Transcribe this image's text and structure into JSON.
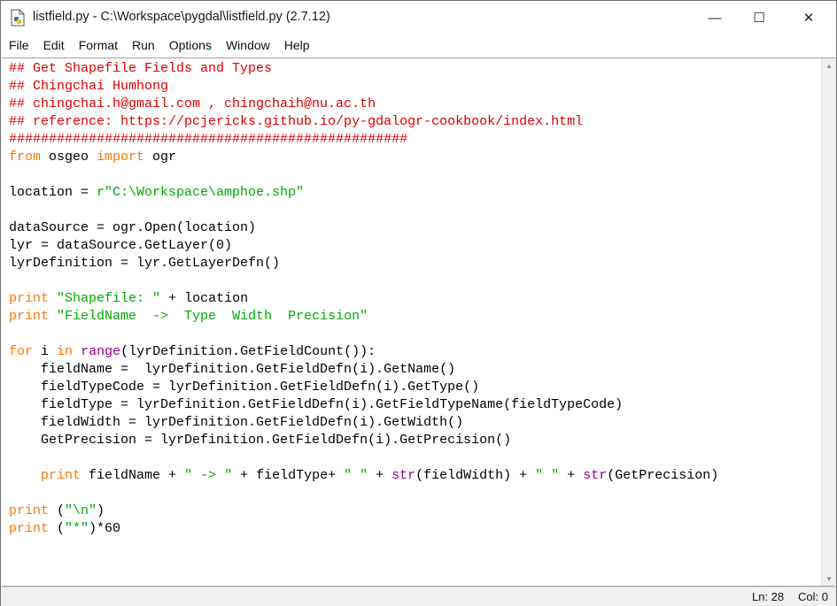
{
  "window": {
    "title": "listfield.py - C:\\Workspace\\pygdal\\listfield.py (2.7.12)",
    "icon": "python-file-icon",
    "controls": {
      "minimize": "—",
      "maximize": "☐",
      "close": "✕"
    }
  },
  "menu": [
    "File",
    "Edit",
    "Format",
    "Run",
    "Options",
    "Window",
    "Help"
  ],
  "colors": {
    "comment": "#dd0000",
    "keyword": "#ff7700",
    "builtin": "#900090",
    "string": "#00aa00",
    "text": "#000000"
  },
  "code_lines": [
    [
      [
        "comment",
        "## Get Shapefile Fields and Types"
      ]
    ],
    [
      [
        "comment",
        "## Chingchai Humhong"
      ]
    ],
    [
      [
        "comment",
        "## chingchai.h@gmail.com , chingchaih@nu.ac.th"
      ]
    ],
    [
      [
        "comment",
        "## reference: https://pcjericks.github.io/py-gdalogr-cookbook/index.html"
      ]
    ],
    [
      [
        "comment",
        "##################################################"
      ]
    ],
    [
      [
        "keyword",
        "from"
      ],
      [
        "plain",
        " osgeo "
      ],
      [
        "keyword",
        "import"
      ],
      [
        "plain",
        " ogr"
      ]
    ],
    [],
    [
      [
        "plain",
        "location = "
      ],
      [
        "string",
        "r\"C:\\Workspace\\amphoe.shp\""
      ]
    ],
    [],
    [
      [
        "plain",
        "dataSource = ogr.Open(location)"
      ]
    ],
    [
      [
        "plain",
        "lyr = dataSource.GetLayer(0)"
      ]
    ],
    [
      [
        "plain",
        "lyrDefinition = lyr.GetLayerDefn()"
      ]
    ],
    [],
    [
      [
        "keyword",
        "print"
      ],
      [
        "plain",
        " "
      ],
      [
        "string",
        "\"Shapefile: \""
      ],
      [
        "plain",
        " + location"
      ]
    ],
    [
      [
        "keyword",
        "print"
      ],
      [
        "plain",
        " "
      ],
      [
        "string",
        "\"FieldName  ->  Type  Width  Precision\""
      ]
    ],
    [],
    [
      [
        "keyword",
        "for"
      ],
      [
        "plain",
        " i "
      ],
      [
        "keyword",
        "in"
      ],
      [
        "plain",
        " "
      ],
      [
        "builtin",
        "range"
      ],
      [
        "plain",
        "(lyrDefinition.GetFieldCount()):"
      ]
    ],
    [
      [
        "plain",
        "    fieldName =  lyrDefinition.GetFieldDefn(i).GetName()"
      ]
    ],
    [
      [
        "plain",
        "    fieldTypeCode = lyrDefinition.GetFieldDefn(i).GetType()"
      ]
    ],
    [
      [
        "plain",
        "    fieldType = lyrDefinition.GetFieldDefn(i).GetFieldTypeName(fieldTypeCode)"
      ]
    ],
    [
      [
        "plain",
        "    fieldWidth = lyrDefinition.GetFieldDefn(i).GetWidth()"
      ]
    ],
    [
      [
        "plain",
        "    GetPrecision = lyrDefinition.GetFieldDefn(i).GetPrecision()"
      ]
    ],
    [],
    [
      [
        "plain",
        "    "
      ],
      [
        "keyword",
        "print"
      ],
      [
        "plain",
        " fieldName + "
      ],
      [
        "string",
        "\" -> \""
      ],
      [
        "plain",
        " + fieldType+ "
      ],
      [
        "string",
        "\" \""
      ],
      [
        "plain",
        " + "
      ],
      [
        "builtin",
        "str"
      ],
      [
        "plain",
        "(fieldWidth) + "
      ],
      [
        "string",
        "\" \""
      ],
      [
        "plain",
        " + "
      ],
      [
        "builtin",
        "str"
      ],
      [
        "plain",
        "(GetPrecision)"
      ]
    ],
    [],
    [
      [
        "keyword",
        "print"
      ],
      [
        "plain",
        " ("
      ],
      [
        "string",
        "\"\\n\""
      ],
      [
        "plain",
        ")"
      ]
    ],
    [
      [
        "keyword",
        "print"
      ],
      [
        "plain",
        " ("
      ],
      [
        "string",
        "\"*\""
      ],
      [
        "plain",
        ")*60"
      ]
    ]
  ],
  "scrollbar": {
    "up_icon": "scroll-up-arrow-icon",
    "down_icon": "scroll-down-arrow-icon",
    "up_glyph": "▲",
    "down_glyph": "▼"
  },
  "status": {
    "line": "Ln: 28",
    "col": "Col: 0"
  }
}
